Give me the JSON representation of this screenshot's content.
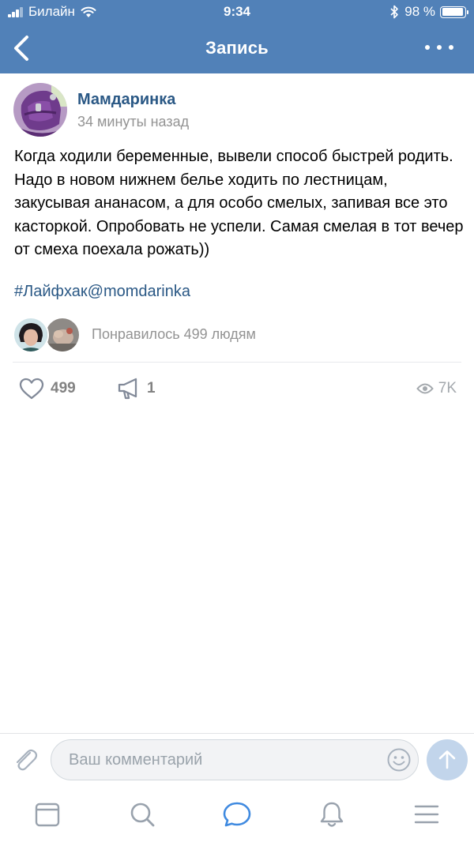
{
  "status_bar": {
    "carrier": "Билайн",
    "time": "9:34",
    "battery": "98 %",
    "icons": [
      "signal-icon",
      "wifi-icon",
      "bluetooth-icon",
      "battery-icon"
    ]
  },
  "nav": {
    "title": "Запись",
    "back_icon": "back-chevron-icon",
    "more_icon": "more-dots-icon"
  },
  "post": {
    "author": "Мамдаринка",
    "time": "34 минуты назад",
    "text": "Когда ходили беременные, вывели способ быстрей родить. Надо в новом нижнем белье ходить по лестницам, закусывая ананасом, а для особо смелых, запивая все это касторкой. Опробовать не успели. Самая смелая в тот вечер от смеха поехала рожать))",
    "hashtag": "#Лайфхак@momdarinka",
    "liked_by": "Понравилось 499 людям",
    "actions": {
      "likes": "499",
      "shares": "1",
      "views": "7K"
    }
  },
  "comment_bar": {
    "placeholder": "Ваш комментарий"
  },
  "tabbar": {
    "items": [
      "news-tab",
      "search-tab",
      "messages-tab",
      "notifications-tab",
      "menu-tab"
    ],
    "active": "messages-tab"
  },
  "colors": {
    "header_blue": "#5181b8",
    "link_blue": "#2a5885",
    "gray_text": "#939393",
    "send_button": "#c2d5eb",
    "tab_icon": "#99a2ad",
    "tab_active": "#3f8ae0"
  }
}
